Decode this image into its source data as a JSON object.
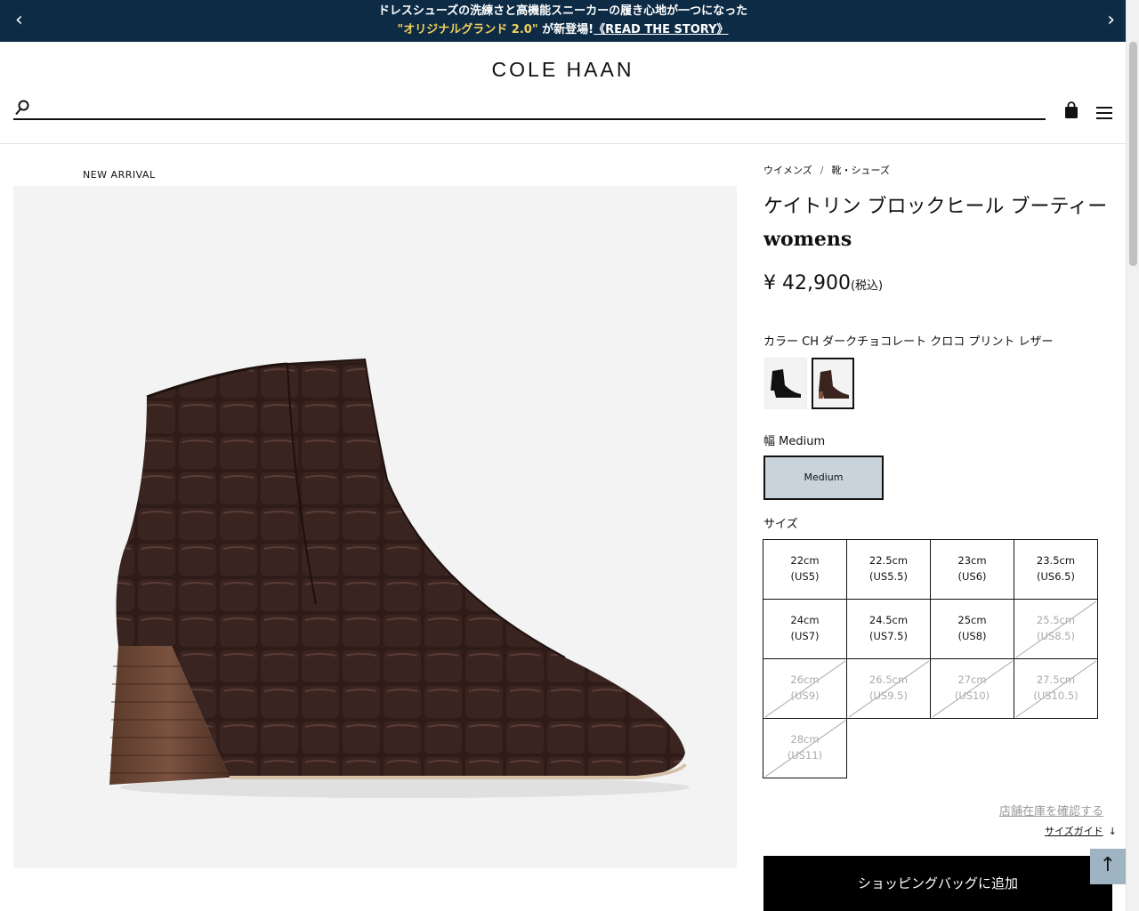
{
  "promo": {
    "line1": "ドレスシューズの洗練さと高機能スニーカーの履き心地が一つになった",
    "highlight": "\"オリジナルグランド 2.0\"",
    "middle": " が新登場!",
    "link": "《READ THE STORY》",
    "prev": "‹",
    "next": "›"
  },
  "header": {
    "logo": "COLE HAAN",
    "search_placeholder": ""
  },
  "product": {
    "badge": "NEW ARRIVAL",
    "breadcrumb": [
      "ウイメンズ",
      "/",
      "靴・シューズ"
    ],
    "title": "ケイトリン ブロックヒール ブーティー",
    "subtitle": "womens",
    "price": "¥ 42,900",
    "tax": "(税込)",
    "color_label": "カラー CH ダークチョコレート クロコ プリント レザー",
    "width_label": "幅 Medium",
    "width_option": "Medium",
    "size_label": "サイズ",
    "sizes": [
      {
        "cm": "22cm",
        "us": "(US5)",
        "available": true
      },
      {
        "cm": "22.5cm",
        "us": "(US5.5)",
        "available": true
      },
      {
        "cm": "23cm",
        "us": "(US6)",
        "available": true
      },
      {
        "cm": "23.5cm",
        "us": "(US6.5)",
        "available": true
      },
      {
        "cm": "24cm",
        "us": "(US7)",
        "available": true
      },
      {
        "cm": "24.5cm",
        "us": "(US7.5)",
        "available": true
      },
      {
        "cm": "25cm",
        "us": "(US8)",
        "available": true
      },
      {
        "cm": "25.5cm",
        "us": "(US8.5)",
        "available": false
      },
      {
        "cm": "26cm",
        "us": "(US9)",
        "available": false
      },
      {
        "cm": "26.5cm",
        "us": "(US9.5)",
        "available": false
      },
      {
        "cm": "27cm",
        "us": "(US10)",
        "available": false
      },
      {
        "cm": "27.5cm",
        "us": "(US10.5)",
        "available": false
      },
      {
        "cm": "28cm",
        "us": "(US11)",
        "available": false
      }
    ],
    "store_link": "店舗在庫を確認する",
    "size_guide": "サイズガイド",
    "size_guide_arrow": "↓",
    "add_to_bag": "ショッピングバッグに追加"
  },
  "back_to_top": "↑",
  "colors": {
    "promo_bg": "#0d2b45",
    "promo_highlight": "#f3d25c",
    "width_selected": "#c9d3db",
    "back_to_top": "#9fb4c2"
  }
}
